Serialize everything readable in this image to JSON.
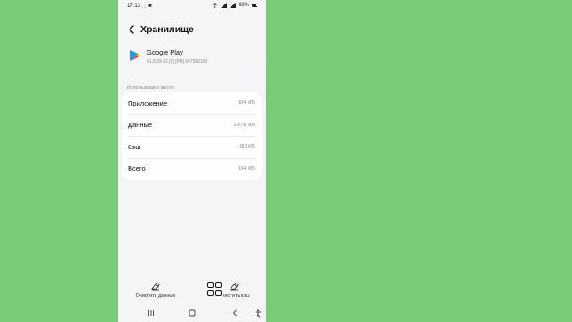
{
  "status_bar": {
    "time": "17:13",
    "left_icons": "⛶ ▣",
    "battery_text": "88%"
  },
  "header": {
    "title": "Хранилище"
  },
  "app": {
    "name": "Google Play",
    "version": "41.6.29-31 [0] [PR] 647066183"
  },
  "storage": {
    "section_label": "Использовано места",
    "rows": [
      {
        "label": "Приложение",
        "value": "104 МБ"
      },
      {
        "label": "Данные",
        "value": "29,78 МБ"
      },
      {
        "label": "Кэш",
        "value": "881 КБ"
      },
      {
        "label": "Всего",
        "value": "134 МБ"
      }
    ]
  },
  "actions": {
    "clear_data": "Очистить данные",
    "clear_cache": "Очистить кэш"
  },
  "icons": {
    "back": "chevron-left-icon",
    "recents": "recents-icon",
    "home": "home-icon",
    "nav_back": "back-icon",
    "accessibility": "accessibility-icon",
    "grid": "grid-icon"
  },
  "colors": {
    "background": "#78cc78",
    "screen": "#f5f4f7",
    "card": "#fdfcfe"
  }
}
